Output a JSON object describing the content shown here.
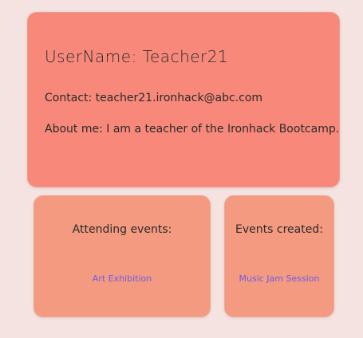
{
  "profile": {
    "username_label": "UserName:",
    "username": "Teacher21",
    "contact_label": "Contact:",
    "contact": "teacher21.ironhack@abc.com",
    "about_label": "About me:",
    "about": "I am a teacher of the Ironhack Bootcamp."
  },
  "attending": {
    "heading": "Attending events:",
    "events": [
      "Art Exhibition"
    ]
  },
  "created": {
    "heading": "Events created:",
    "events": [
      "Music Jam Session"
    ]
  }
}
